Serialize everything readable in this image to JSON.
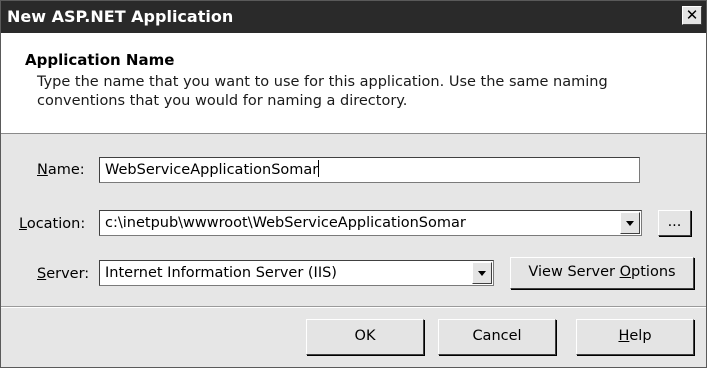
{
  "window": {
    "title": "New ASP.NET Application",
    "close_glyph": "✕"
  },
  "header": {
    "title": "Application Name",
    "description": "Type the name that you want to use for this application.  Use the same naming conventions that you would for naming a directory."
  },
  "form": {
    "name": {
      "label_mnemonic": "N",
      "label_rest": "ame:",
      "value": "WebServiceApplicationSomar"
    },
    "location": {
      "label_mnemonic": "L",
      "label_rest": "ocation:",
      "value": "c:\\inetpub\\wwwroot\\WebServiceApplicationSomar",
      "browse_label": "..."
    },
    "server": {
      "label_mnemonic": "S",
      "label_rest": "erver:",
      "value": "Internet Information Server (IIS)",
      "options_label_pre": "View Server ",
      "options_label_mnemonic": "O",
      "options_label_post": "ptions"
    }
  },
  "buttons": {
    "ok": "OK",
    "cancel": "Cancel",
    "help_mnemonic": "H",
    "help_rest": "elp"
  },
  "colors": {
    "titlebar": "#2a2a2a",
    "dialog_bg": "#e6e6e6",
    "header_bg": "#ffffff"
  }
}
